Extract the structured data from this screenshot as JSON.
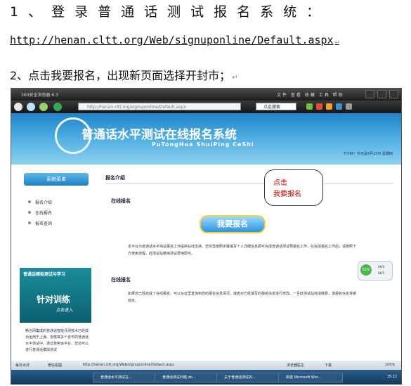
{
  "doc": {
    "line1": "1、登录普通话测试报名系统：",
    "url": "http://henan.cltt.org/Web/signuponline/Default.aspx",
    "line3": "2、点击我要报名，出现新页面选择开封市；"
  },
  "browser": {
    "title": "360安全浏览器 6.3",
    "menu": "文件 查看 收藏 工具 帮助",
    "address": "http://henan.cltt.org/signuponline/Default.aspx",
    "search_placeholder": "点此搜索"
  },
  "page": {
    "system_title": "普通话水平测试在线报名系统",
    "pinyin": "PuTongHua ShuiPing CeShi",
    "greeting": "下午好！今天是5月15日 星期四",
    "menu_header": "系统菜单",
    "menu_items": [
      "报名介绍",
      "在线报名",
      "报名查询"
    ],
    "section_title": "报名介绍",
    "online_signup": "在线报名",
    "signup_button": "我要报名",
    "intro_text": "本平台为普通话水平测试报名工作提供在线支持。您仅需按照步骤填写个人详细信息即可完成普通话测试预报名工作，在完成报名工作后，请按照下方使用流程，赴测试站缴纳测试费用即可。",
    "online_signup_2": "在线报名",
    "signup_text": "如果您已经完成了在线报名，可以在这里查询到您的报名信息情况，或者对已经填写的报名信息进行修改。一旦赴测试站完成缴费，该报名信息将被锁定。",
    "promo_title": "普通话模拟测试与学习",
    "promo_big": "针对训练",
    "promo_enter": "点击进入",
    "side_text": "畅言网集成的普通话智能评测技术已经成功运用于上海、安徽等多个省市的普通话水平测试中。通过使用该平台，您还可以进行普通话模拟测试"
  },
  "callout": {
    "line1": "点击",
    "line2": "我要报名"
  },
  "speed": {
    "percent": "52%",
    "up": "0K/S",
    "down": "0K/S"
  },
  "status": {
    "left1": "每日点评",
    "left2": "微信看图",
    "url": "http://henan.cltt.org/Web/signuponline/Default.aspx",
    "doctor": "浏览器医生",
    "download": "下载",
    "zoom": "100%"
  },
  "taskbar": {
    "tasks": [
      "普通话水平测试在...",
      "普通话测试问题.do...",
      "关于普通话测试的...",
      "新建 Microsoft Wor..."
    ],
    "clock": "15:22"
  }
}
